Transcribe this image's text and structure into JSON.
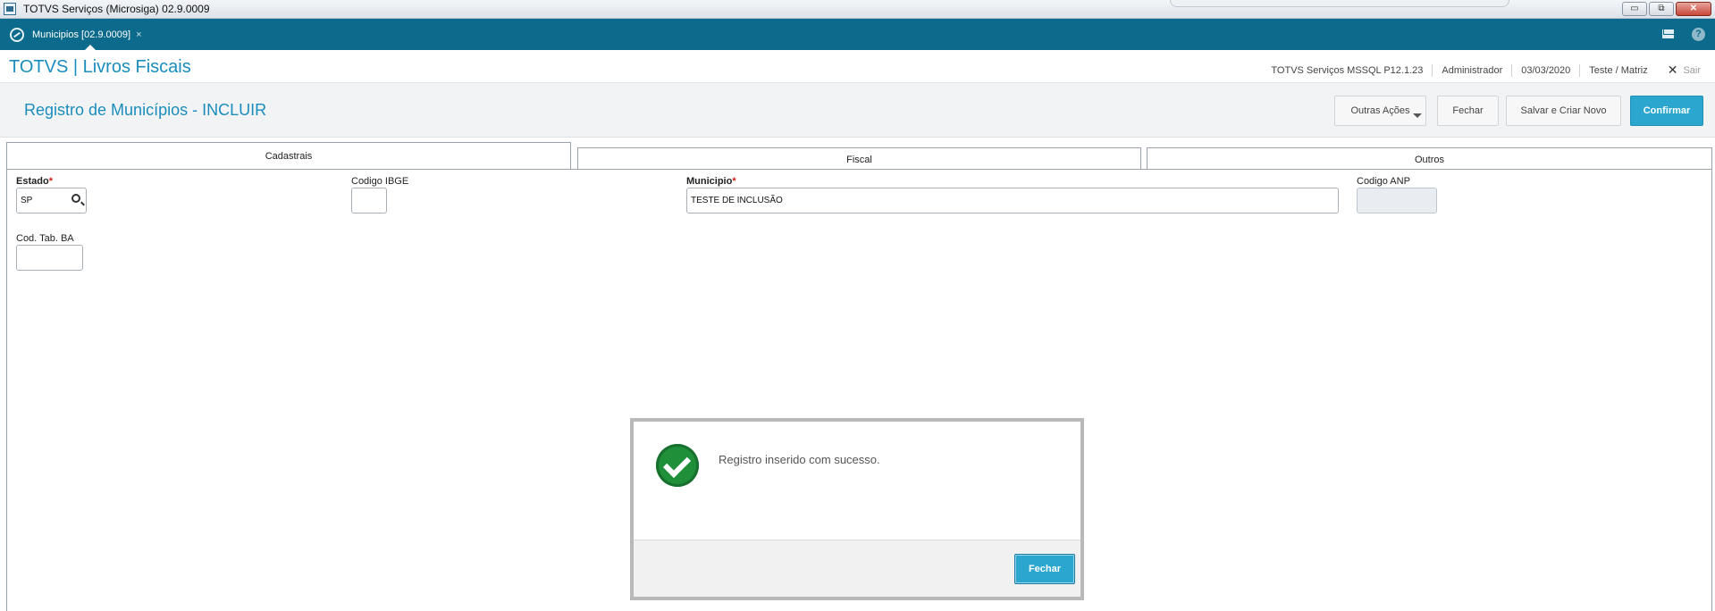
{
  "window": {
    "title": "TOTVS Serviços (Microsiga) 02.9.0009",
    "controls": {
      "minimize": "▭",
      "restore": "⧉",
      "close": "✕"
    }
  },
  "tabbar": {
    "tab_label": "Municipios [02.9.0009]",
    "tab_close": "×",
    "help": "?"
  },
  "header": {
    "brand": "TOTVS | Livros Fiscais",
    "environment": "TOTVS Serviços MSSQL P12.1.23",
    "user": "Administrador",
    "date": "03/03/2020",
    "company": "Teste / Matriz",
    "exit_x": "✕",
    "exit_label": "Sair"
  },
  "page": {
    "title": "Registro de Municípios - INCLUIR",
    "buttons": {
      "other_actions": "Outras Ações",
      "close": "Fechar",
      "save_new": "Salvar e Criar Novo",
      "confirm": "Confirmar"
    }
  },
  "tabs": [
    "Cadastrais",
    "Fiscal",
    "Outros"
  ],
  "form": {
    "required_mark": "*",
    "estado": {
      "label": "Estado",
      "value": "SP"
    },
    "codigo_ibge": {
      "label": "Codigo IBGE",
      "value": ""
    },
    "municipio": {
      "label": "Municipio",
      "value": "TESTE DE INCLUSÃO"
    },
    "codigo_anp": {
      "label": "Codigo ANP",
      "value": ""
    },
    "cod_tab_ba": {
      "label": "Cod. Tab. BA",
      "value": ""
    }
  },
  "modal": {
    "message": "Registro inserido com sucesso.",
    "button": "Fechar",
    "icon": "check-circle-icon"
  },
  "colors": {
    "accent": "#1a8dbd",
    "tabbar": "#0c6b8c",
    "primary_button": "#2aa6cf",
    "success": "#1f8f3a",
    "required": "#d0201b"
  }
}
